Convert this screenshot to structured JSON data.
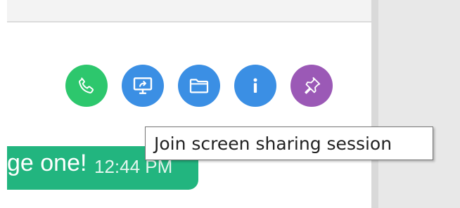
{
  "toolbar": {
    "buttons": [
      {
        "name": "call",
        "icon": "phone-icon",
        "color": "#2dc76d"
      },
      {
        "name": "screen-share",
        "icon": "monitor-share-icon",
        "color": "#3b8fe4"
      },
      {
        "name": "files",
        "icon": "folder-icon",
        "color": "#3b8fe4"
      },
      {
        "name": "info",
        "icon": "info-icon",
        "color": "#3b8fe4"
      },
      {
        "name": "pin",
        "icon": "pin-icon",
        "color": "#9b59b6"
      }
    ]
  },
  "message": {
    "text": "ge one!",
    "time": "12:44 PM",
    "bubble_color": "#22b57f"
  },
  "tooltip": {
    "text": "Join screen sharing session"
  }
}
